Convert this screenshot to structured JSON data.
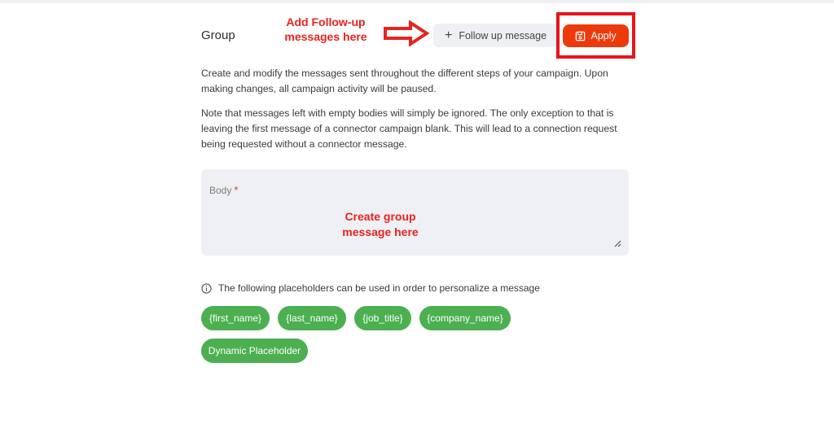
{
  "header": {
    "title": "Group",
    "follow_up_label": "Follow up message",
    "apply_label": "Apply"
  },
  "annotations": {
    "follow_up_hint": "Add Follow-up messages here",
    "body_hint": "Create group message here"
  },
  "description": {
    "paragraph1": "Create and modify the messages sent throughout the different steps of your campaign. Upon making changes, all campaign activity will be paused.",
    "paragraph2": "Note that messages left with empty bodies will simply be ignored. The only exception to that is leaving the first message of a connector campaign blank. This will lead to a connection request being requested without a connector message."
  },
  "body_field": {
    "label": "Body",
    "required_mark": "*"
  },
  "placeholders": {
    "info_text": "The following placeholders can be used in order to personalize a message",
    "chips": [
      "{first_name}",
      "{last_name}",
      "{job_title}",
      "{company_name}",
      "Dynamic Placeholder"
    ]
  },
  "colors": {
    "accent": "#ec3a0c",
    "annotation": "#e8231f",
    "chip": "#4caf50",
    "field_bg": "#eef0f4"
  }
}
